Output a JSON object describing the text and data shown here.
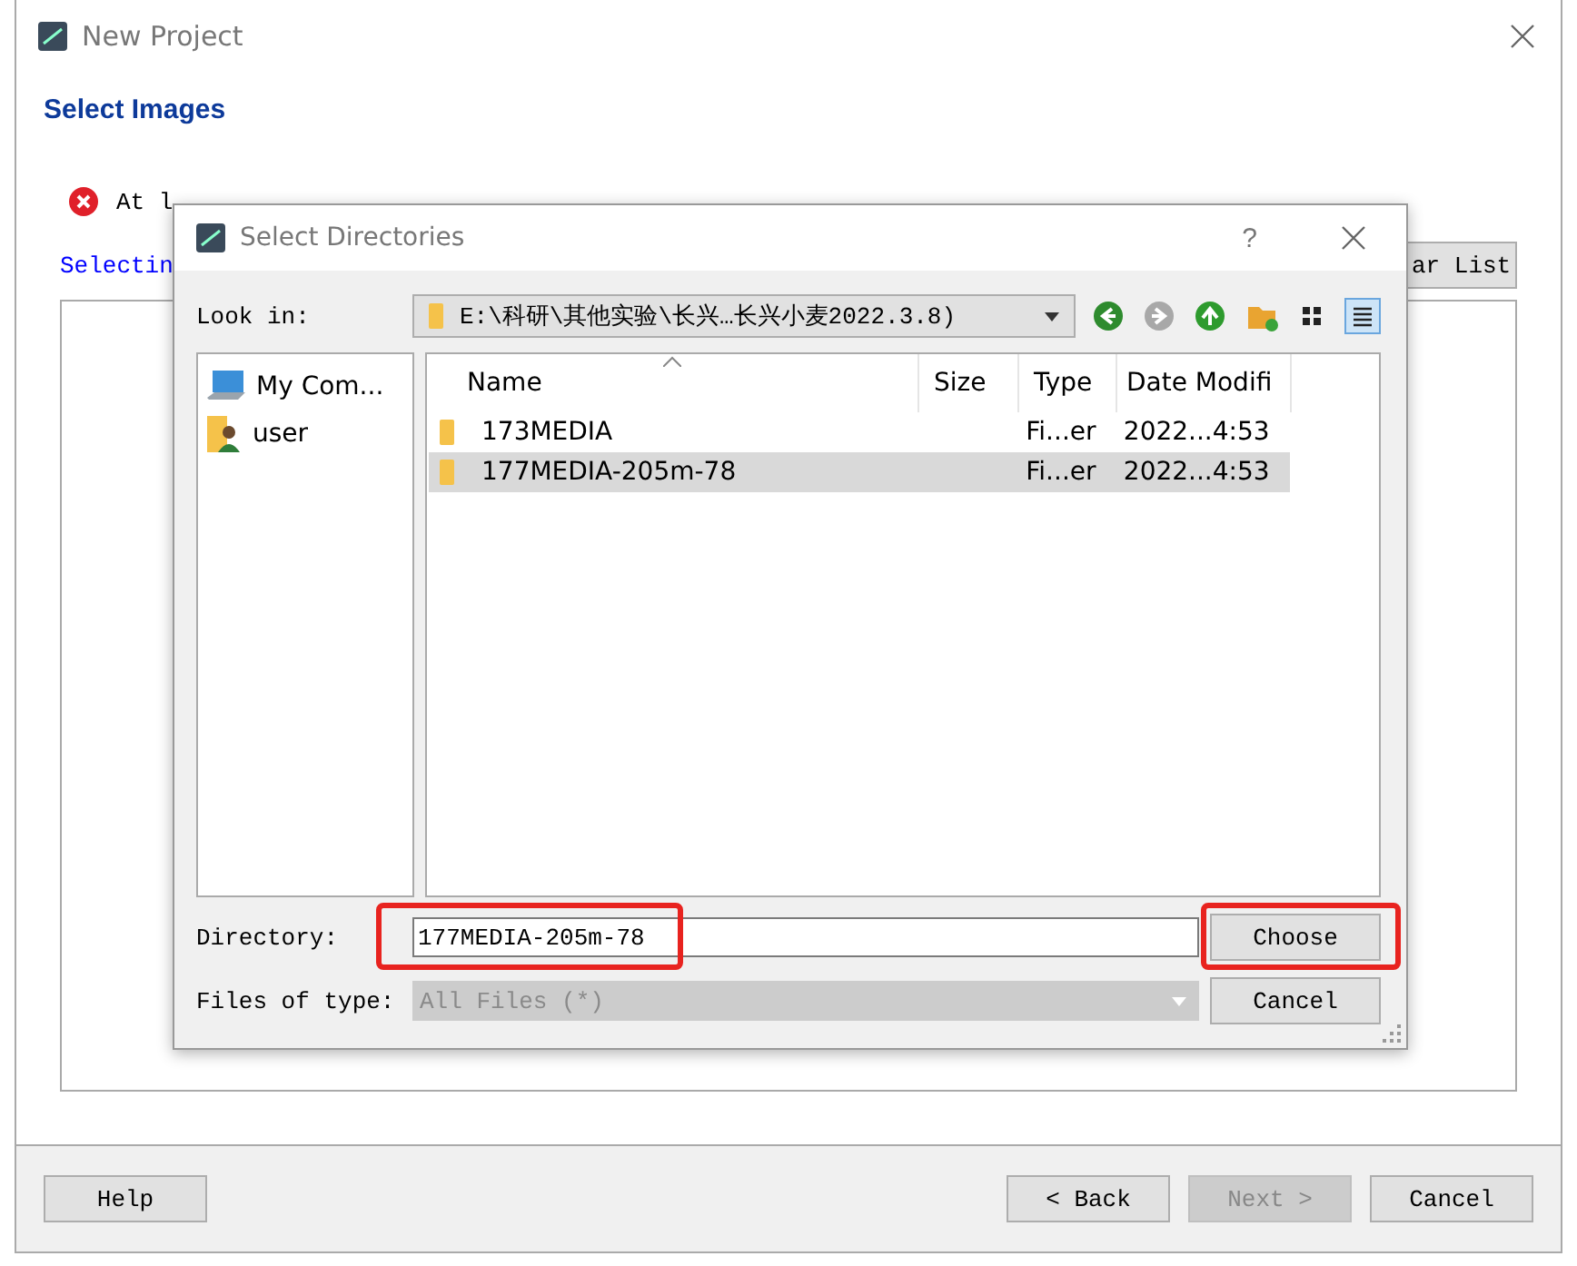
{
  "main_window": {
    "title": "New Project",
    "heading": "Select Images",
    "error_message": "At l",
    "selecting_label": "Selectin",
    "clear_button": "ar List",
    "buttons": [
      {
        "label": "Help",
        "disabled": false
      },
      {
        "label": "< Back",
        "disabled": false
      },
      {
        "label": "Next >",
        "disabled": true
      },
      {
        "label": "Cancel",
        "disabled": false
      }
    ]
  },
  "dialog": {
    "title": "Select Directories",
    "help": "?",
    "look_in_label": "Look in:",
    "path": "E:\\科研\\其他实验\\长兴…长兴小麦2022.3.8)",
    "view_buttons": [
      {
        "kind": "icons",
        "selected": false
      },
      {
        "kind": "detail",
        "selected": true
      }
    ],
    "sidebar": [
      {
        "label": "My Com...",
        "kind": "computer"
      },
      {
        "label": "user",
        "kind": "user"
      }
    ],
    "columns": [
      "Name",
      "Size",
      "Type",
      "Date Modifi"
    ],
    "rows": [
      {
        "name": "173MEDIA",
        "type": "Fi...er",
        "date": "2022...4:53",
        "selected": false
      },
      {
        "name": "177MEDIA-205m-78",
        "type": "Fi...er",
        "date": "2022...4:53",
        "selected": true
      }
    ],
    "directory_label": "Directory:",
    "directory_value": "177MEDIA-205m-78",
    "files_of_type_label": "Files of type:",
    "file_type": {
      "value": "All Files (*)",
      "disabled": true
    },
    "buttons": [
      "Choose",
      "Cancel"
    ]
  }
}
